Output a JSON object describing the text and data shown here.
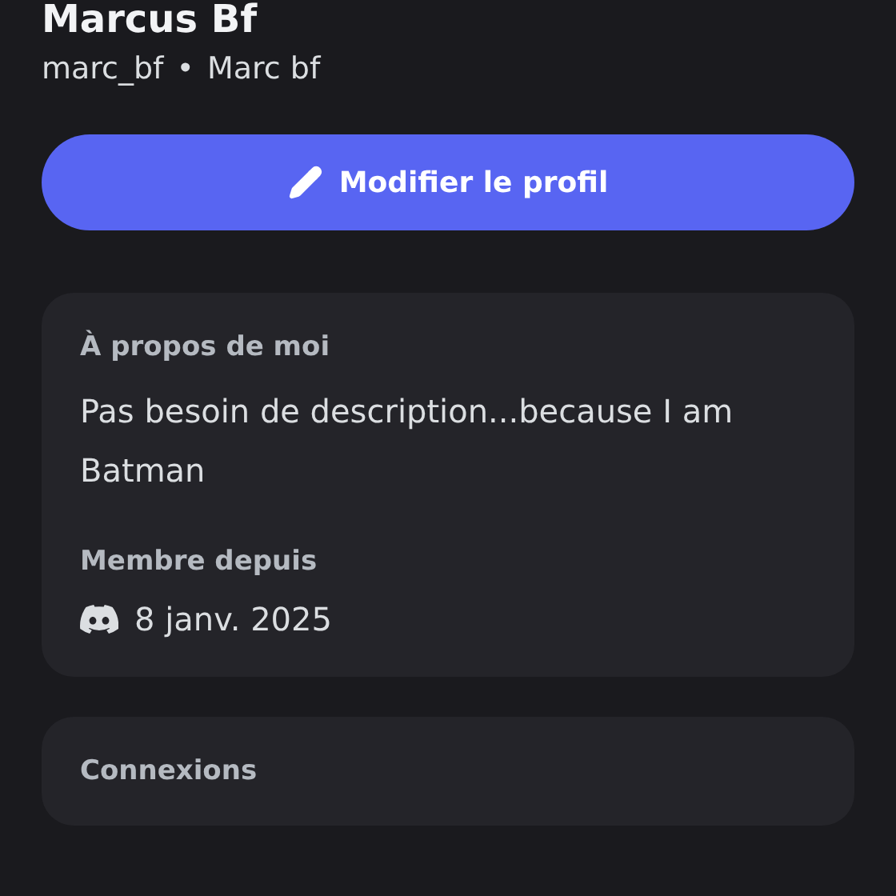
{
  "profile": {
    "display_name": "Marcus Bf",
    "username": "marc_bf",
    "separator": "•",
    "global_name": "Marc bf"
  },
  "edit_button": {
    "label": "Modifier le profil"
  },
  "about": {
    "heading": "À propos de moi",
    "text": "Pas besoin de description...because I am Batman"
  },
  "member_since": {
    "heading": "Membre depuis",
    "date": "8 janv. 2025"
  },
  "connections": {
    "heading": "Connexions"
  }
}
